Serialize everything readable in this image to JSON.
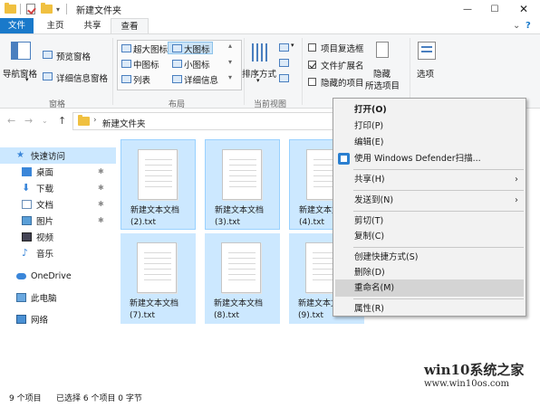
{
  "window": {
    "title": "新建文件夹"
  },
  "menu": {
    "tabs": [
      {
        "label": "文件"
      },
      {
        "label": "主页"
      },
      {
        "label": "共享"
      },
      {
        "label": "查看"
      }
    ]
  },
  "ribbon": {
    "nav_pane": "导航窗格",
    "preview_pane": "预览窗格",
    "details_pane": "详细信息窗格",
    "pane_group": "窗格",
    "layout": {
      "items": [
        "超大图标",
        "大图标",
        "中图标",
        "小图标",
        "列表",
        "详细信息"
      ],
      "selected": "大图标"
    },
    "layout_group": "布局",
    "sort_by": "排序方式",
    "current_view_group": "当前视图",
    "checkboxes": [
      {
        "label": "项目复选框",
        "checked": false
      },
      {
        "label": "文件扩展名",
        "checked": true
      },
      {
        "label": "隐藏的项目",
        "checked": false
      }
    ],
    "hide_selected_line1": "隐藏",
    "hide_selected_line2": "所选项目",
    "options": "选项"
  },
  "address": {
    "path": "新建文件夹"
  },
  "sidebar": {
    "items": [
      {
        "label": "快速访问",
        "icon": "star-icon",
        "pinned": false
      },
      {
        "label": "桌面",
        "icon": "desktop-icon",
        "pinned": true
      },
      {
        "label": "下载",
        "icon": "download-icon",
        "pinned": true
      },
      {
        "label": "文档",
        "icon": "documents-icon",
        "pinned": true
      },
      {
        "label": "图片",
        "icon": "pictures-icon",
        "pinned": true
      },
      {
        "label": "视频",
        "icon": "videos-icon",
        "pinned": false
      },
      {
        "label": "音乐",
        "icon": "music-icon",
        "pinned": false
      },
      {
        "label": "OneDrive",
        "icon": "cloud-icon",
        "pinned": false
      },
      {
        "label": "此电脑",
        "icon": "computer-icon",
        "pinned": false
      },
      {
        "label": "网络",
        "icon": "network-icon",
        "pinned": false
      }
    ]
  },
  "files": [
    {
      "line1": "新建文本文档",
      "line2": "(2).txt"
    },
    {
      "line1": "新建文本文档",
      "line2": "(3).txt"
    },
    {
      "line1": "新建文本文档",
      "line2": "(4).txt"
    },
    {
      "line1": "新建文本文档",
      "line2": "(7).txt"
    },
    {
      "line1": "新建文本文档",
      "line2": "(8).txt"
    },
    {
      "line1": "新建文本文档",
      "line2": "(9).txt"
    }
  ],
  "context_menu": {
    "items": [
      {
        "label": "打开(O)",
        "bold": true
      },
      {
        "label": "打印(P)"
      },
      {
        "label": "编辑(E)"
      },
      {
        "label": "使用 Windows Defender扫描..."
      },
      {
        "label": "共享(H)"
      },
      {
        "label": "发送到(N)"
      },
      {
        "label": "剪切(T)"
      },
      {
        "label": "复制(C)"
      },
      {
        "label": "创建快捷方式(S)"
      },
      {
        "label": "删除(D)"
      },
      {
        "label": "重命名(M)",
        "highlighted": true
      },
      {
        "label": "属性(R)"
      }
    ]
  },
  "status": {
    "count": "9 个项目",
    "selected": "已选择 6 个项目  0 字节"
  },
  "watermark": {
    "line1": "win10系统之家",
    "line2": "www.win10os.com"
  },
  "colors": {
    "accent": "#1979ca",
    "selection": "#cce8ff",
    "selection_border": "#99d1ff",
    "menu_bg": "#f2f2f2",
    "menu_highlight": "#d4d4d4"
  }
}
